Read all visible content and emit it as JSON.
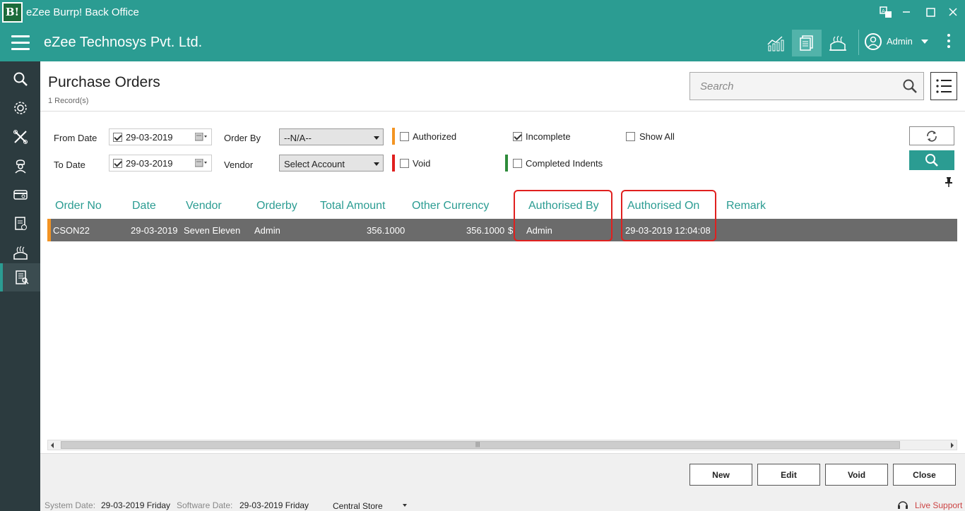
{
  "app": {
    "logo_text": "B!",
    "title": "eZee Burrp! Back Office"
  },
  "header": {
    "company": "eZee Technosys Pvt. Ltd.",
    "user": "Admin"
  },
  "page": {
    "title": "Purchase Orders",
    "records": "1 Record(s)"
  },
  "search": {
    "placeholder": "Search"
  },
  "filters": {
    "from_date_label": "From Date",
    "from_date_value": "29-03-2019",
    "to_date_label": "To Date",
    "to_date_value": "29-03-2019",
    "order_by_label": "Order By",
    "order_by_value": "--N/A--",
    "vendor_label": "Vendor",
    "vendor_value": "Select Account",
    "authorized_label": "Authorized",
    "void_label": "Void",
    "incomplete_label": "Incomplete",
    "completed_indents_label": "Completed Indents",
    "show_all_label": "Show All",
    "authorized_color": "#f39423",
    "void_color": "#e0201f",
    "completed_color": "#2e8b3a"
  },
  "table": {
    "columns": [
      "Order No",
      "Date",
      "Vendor",
      "Orderby",
      "Total Amount",
      "Other Currency",
      "Authorised By",
      "Authorised On",
      "Remark"
    ],
    "rows": [
      {
        "order_no": "CSON22",
        "date": "29-03-2019",
        "vendor": "Seven Eleven",
        "orderby": "Admin",
        "total_amount": "356.1000",
        "other_currency": "356.1000",
        "currency_symbol": "$",
        "authorised_by": "Admin",
        "authorised_on": "29-03-2019 12:04:08",
        "remark": ""
      }
    ]
  },
  "actions": {
    "new": "New",
    "edit": "Edit",
    "void": "Void",
    "close": "Close"
  },
  "statusbar": {
    "system_date_label": "System Date:",
    "system_date": "29-03-2019 Friday",
    "software_date_label": "Software Date:",
    "software_date": "29-03-2019 Friday",
    "store": "Central Store",
    "live_support": "Live Support"
  },
  "colors": {
    "primary": "#2b9c92",
    "sidebar": "#2c3b3f",
    "row_selected": "#6b6b6b",
    "highlight": "#e0201f"
  }
}
